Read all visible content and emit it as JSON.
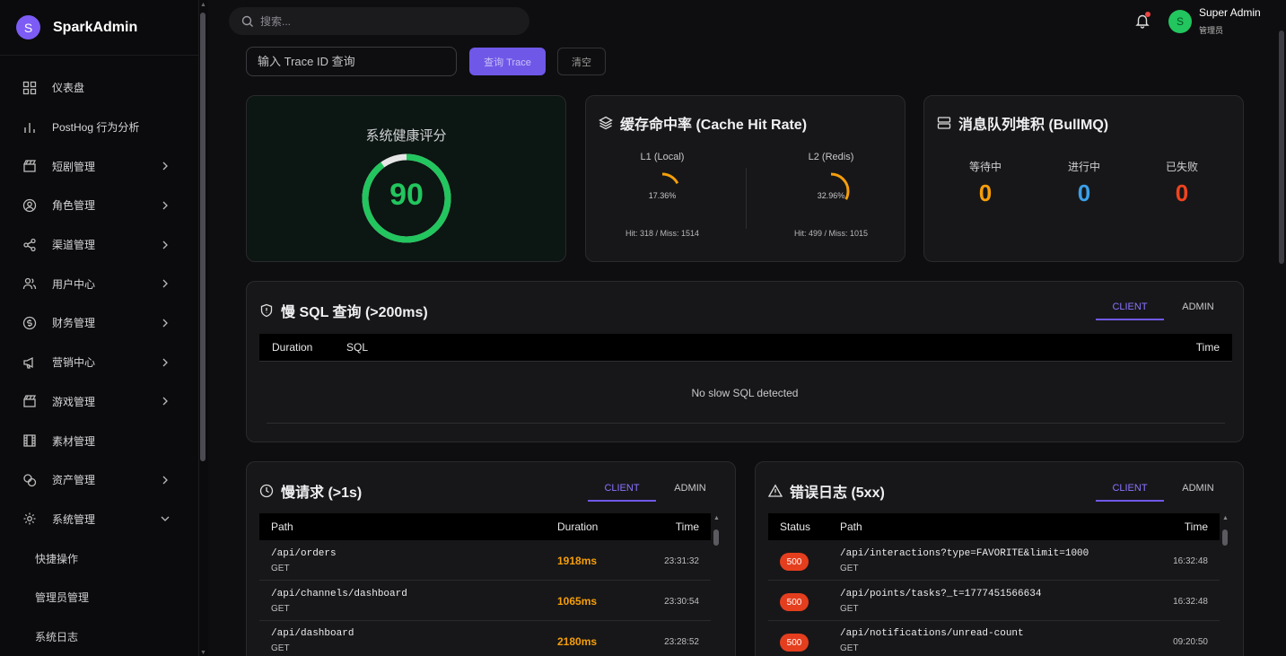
{
  "brand": {
    "logo_letter": "S",
    "name": "SparkAdmin"
  },
  "sidebar": {
    "items": [
      {
        "icon": "dashboard-icon",
        "label": "仪表盘"
      },
      {
        "icon": "bar-chart-icon",
        "label": "PostHog 行为分析"
      },
      {
        "icon": "clapperboard-icon",
        "label": "短剧管理"
      },
      {
        "icon": "user-circle-icon",
        "label": "角色管理"
      },
      {
        "icon": "share-icon",
        "label": "渠道管理"
      },
      {
        "icon": "users-icon",
        "label": "用户中心"
      },
      {
        "icon": "dollar-icon",
        "label": "财务管理"
      },
      {
        "icon": "megaphone-icon",
        "label": "营销中心"
      },
      {
        "icon": "clapperboard-icon",
        "label": "游戏管理"
      },
      {
        "icon": "film-icon",
        "label": "素材管理"
      },
      {
        "icon": "coins-icon",
        "label": "资产管理"
      },
      {
        "icon": "gear-icon",
        "label": "系统管理"
      }
    ],
    "sub_items": [
      "快捷操作",
      "管理员管理",
      "系统日志"
    ]
  },
  "search": {
    "placeholder": "搜索..."
  },
  "user": {
    "avatar_letter": "S",
    "name": "Super Admin",
    "role": "管理员"
  },
  "trace": {
    "placeholder": "输入 Trace ID 查询",
    "query_label": "查询 Trace",
    "clear_label": "清空"
  },
  "health": {
    "title": "系统健康评分",
    "score": "90",
    "score_fraction": 0.9,
    "color": "#22c55e"
  },
  "cache": {
    "title": "缓存命中率 (Cache Hit Rate)",
    "l1": {
      "label": "L1 (Local)",
      "pct": "17.36%",
      "fraction": 0.1736,
      "stats": "Hit: 318 / Miss: 1514"
    },
    "l2": {
      "label": "L2 (Redis)",
      "pct": "32.96%",
      "fraction": 0.3296,
      "stats": "Hit: 499 / Miss: 1015"
    },
    "ring_color": "#f59e0b"
  },
  "queue": {
    "title": "消息队列堆积 (BullMQ)",
    "waiting": {
      "label": "等待中",
      "value": "0",
      "color": "#f59e0b"
    },
    "active": {
      "label": "进行中",
      "value": "0",
      "color": "#3b9fe8"
    },
    "failed": {
      "label": "已失败",
      "value": "0",
      "color": "#ef4420"
    }
  },
  "slow_sql": {
    "title": "慢 SQL 查询 (>200ms)",
    "tabs": [
      "CLIENT",
      "ADMIN"
    ],
    "columns": [
      "Duration",
      "SQL",
      "Time"
    ],
    "empty": "No slow SQL detected"
  },
  "slow_requests": {
    "title": "慢请求 (>1s)",
    "tabs": [
      "CLIENT",
      "ADMIN"
    ],
    "columns": [
      "Path",
      "Duration",
      "Time"
    ],
    "rows": [
      {
        "path": "/api/orders",
        "method": "GET",
        "duration": "1918ms",
        "time": "23:31:32"
      },
      {
        "path": "/api/channels/dashboard",
        "method": "GET",
        "duration": "1065ms",
        "time": "23:30:54"
      },
      {
        "path": "/api/dashboard",
        "method": "GET",
        "duration": "2180ms",
        "time": "23:28:52"
      }
    ]
  },
  "errors": {
    "title": "错误日志 (5xx)",
    "tabs": [
      "CLIENT",
      "ADMIN"
    ],
    "columns": [
      "Status",
      "Path",
      "Time"
    ],
    "rows": [
      {
        "status": "500",
        "path": "/api/interactions?type=FAVORITE&limit=1000",
        "method": "GET",
        "time": "16:32:48"
      },
      {
        "status": "500",
        "path": "/api/points/tasks?_t=1777451566634",
        "method": "GET",
        "time": "16:32:48"
      },
      {
        "status": "500",
        "path": "/api/notifications/unread-count",
        "method": "GET",
        "time": "09:20:50"
      }
    ]
  },
  "colors": {
    "accent": "#6f58e8",
    "danger": "#e53e1e",
    "warning": "#f59e0b"
  }
}
